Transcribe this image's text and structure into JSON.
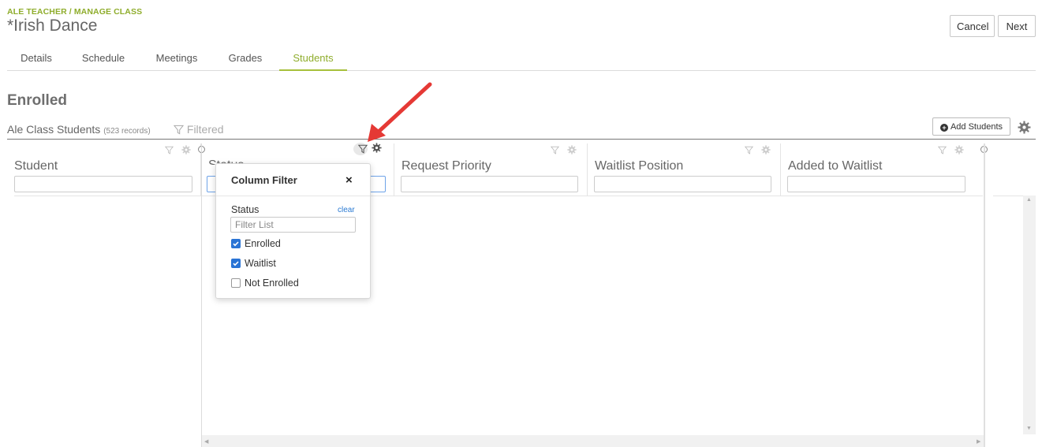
{
  "header": {
    "breadcrumb": "ALE TEACHER / MANAGE CLASS",
    "title": "*Irish Dance",
    "cancel_label": "Cancel",
    "next_label": "Next"
  },
  "tabs": [
    {
      "label": "Details",
      "active": false
    },
    {
      "label": "Schedule",
      "active": false
    },
    {
      "label": "Meetings",
      "active": false
    },
    {
      "label": "Grades",
      "active": false
    },
    {
      "label": "Students",
      "active": true
    }
  ],
  "section": {
    "title": "Enrolled"
  },
  "grid": {
    "title": "Ale Class Students",
    "count": "(523 records)",
    "filtered_label": "Filtered",
    "add_button_label": "Add Students",
    "columns": [
      {
        "label": "Student",
        "filter_active": false
      },
      {
        "label": "Status",
        "filter_active": true
      },
      {
        "label": "Request Priority",
        "filter_active": false
      },
      {
        "label": "Waitlist Position",
        "filter_active": false
      },
      {
        "label": "Added to Waitlist",
        "filter_active": false
      }
    ]
  },
  "column_filter": {
    "title": "Column Filter",
    "close": "×",
    "field_label": "Status",
    "clear_label": "clear",
    "filter_placeholder": "Filter List",
    "options": [
      {
        "label": "Enrolled",
        "checked": true
      },
      {
        "label": "Waitlist",
        "checked": true
      },
      {
        "label": "Not Enrolled",
        "checked": false
      }
    ]
  },
  "colors": {
    "accent": "#8fad2c",
    "checkbox": "#2a74d5",
    "link": "#2a7ad3",
    "annotation_arrow": "#e53935"
  },
  "icons": {
    "filter": "filter-icon",
    "gear": "gear-icon",
    "close": "close-icon",
    "add": "plus-circle-icon"
  }
}
